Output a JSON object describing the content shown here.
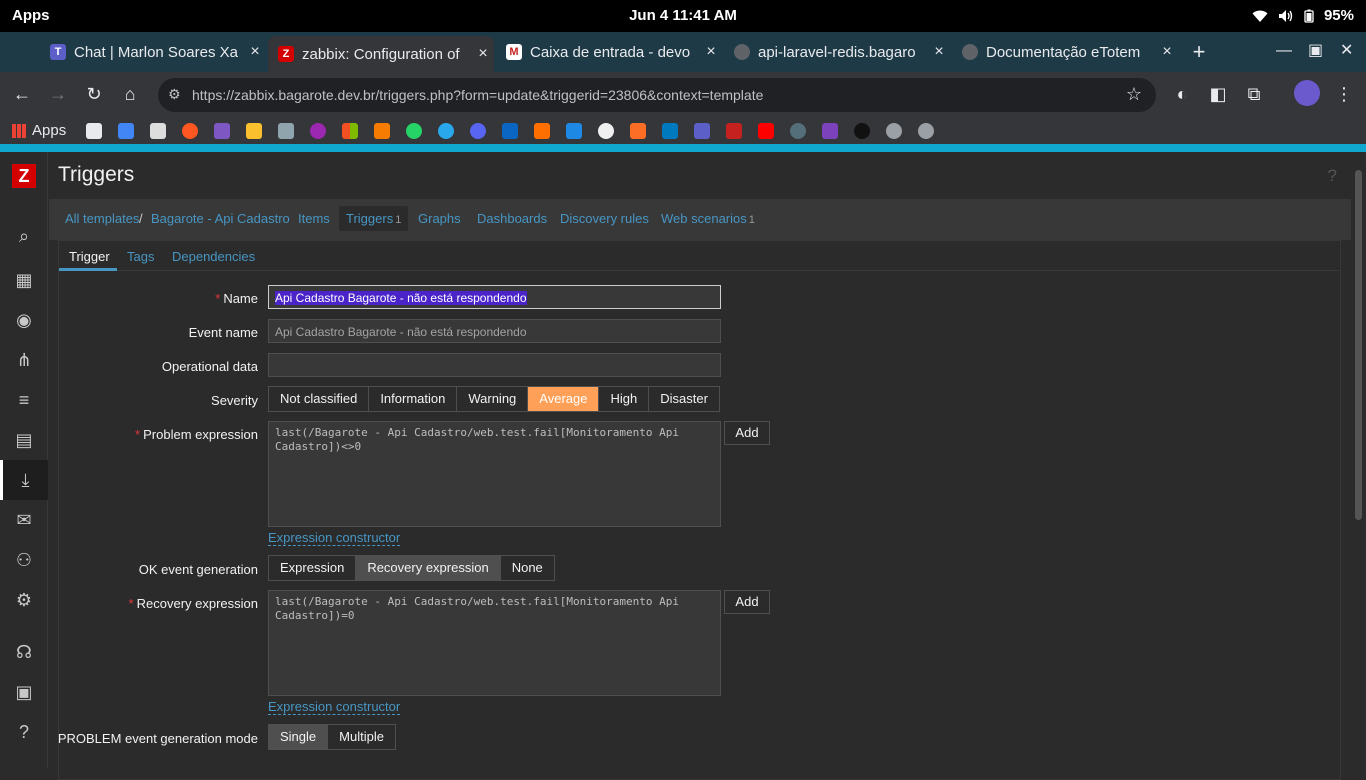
{
  "os": {
    "apps_label": "Apps",
    "clock": "Jun 4  11:41 AM",
    "battery": "95%"
  },
  "browser": {
    "tabs": [
      {
        "title": "Chat | Marlon Soares Xa",
        "favicon_color": "#5b5fc7",
        "favicon": "teams-icon"
      },
      {
        "title": "zabbix: Configuration of",
        "favicon_color": "#d40000",
        "favicon": "zabbix-icon",
        "favicon_letter": "Z"
      },
      {
        "title": "Caixa de entrada - devo",
        "favicon_color": "#c5221f",
        "favicon": "gmail-icon",
        "favicon_letter": "M"
      },
      {
        "title": "api-laravel-redis.bagaro",
        "favicon_color": "#5f6368",
        "favicon": "globe-icon"
      },
      {
        "title": "Documentação eTotem",
        "favicon_color": "#5f6368",
        "favicon": "globe-icon"
      }
    ],
    "close_glyph": "×",
    "url": "https://zabbix.bagarote.dev.br/triggers.php?form=update&triggerid=23806&context=template",
    "bookmarks_apps_label": "Apps"
  },
  "zabbix": {
    "logo_letter": "Z",
    "page_title": "Triggers",
    "help_glyph": "?",
    "breadcrumb": {
      "all_templates": "All templates",
      "template": "Bagarote - Api Cadastro"
    },
    "nav": {
      "items": "Items",
      "triggers": "Triggers",
      "triggers_count": "1",
      "graphs": "Graphs",
      "dashboards": "Dashboards",
      "discovery": "Discovery rules",
      "web": "Web scenarios",
      "web_count": "1"
    },
    "form_tabs": {
      "trigger": "Trigger",
      "tags": "Tags",
      "dependencies": "Dependencies"
    },
    "form": {
      "name_label": "Name",
      "name_value": "Api Cadastro Bagarote - não está respondendo",
      "event_name_label": "Event name",
      "event_name_placeholder": "Api Cadastro Bagarote - não está respondendo",
      "opdata_label": "Operational data",
      "opdata_value": "",
      "severity_label": "Severity",
      "severity_options": [
        "Not classified",
        "Information",
        "Warning",
        "Average",
        "High",
        "Disaster"
      ],
      "severity_selected": "Average",
      "problem_expr_label": "Problem expression",
      "problem_expr_value": "last(/Bagarote - Api Cadastro/web.test.fail[Monitoramento Api Cadastro])<>0",
      "add_label": "Add",
      "expr_constructor": "Expression constructor",
      "ok_event_label": "OK event generation",
      "ok_event_options": [
        "Expression",
        "Recovery expression",
        "None"
      ],
      "ok_event_selected": "Recovery expression",
      "recovery_expr_label": "Recovery expression",
      "recovery_expr_value": "last(/Bagarote - Api Cadastro/web.test.fail[Monitoramento Api Cadastro])=0",
      "problem_mode_label": "PROBLEM event generation mode",
      "problem_mode_options": [
        "Single",
        "Multiple"
      ],
      "problem_mode_selected": "Single"
    }
  }
}
